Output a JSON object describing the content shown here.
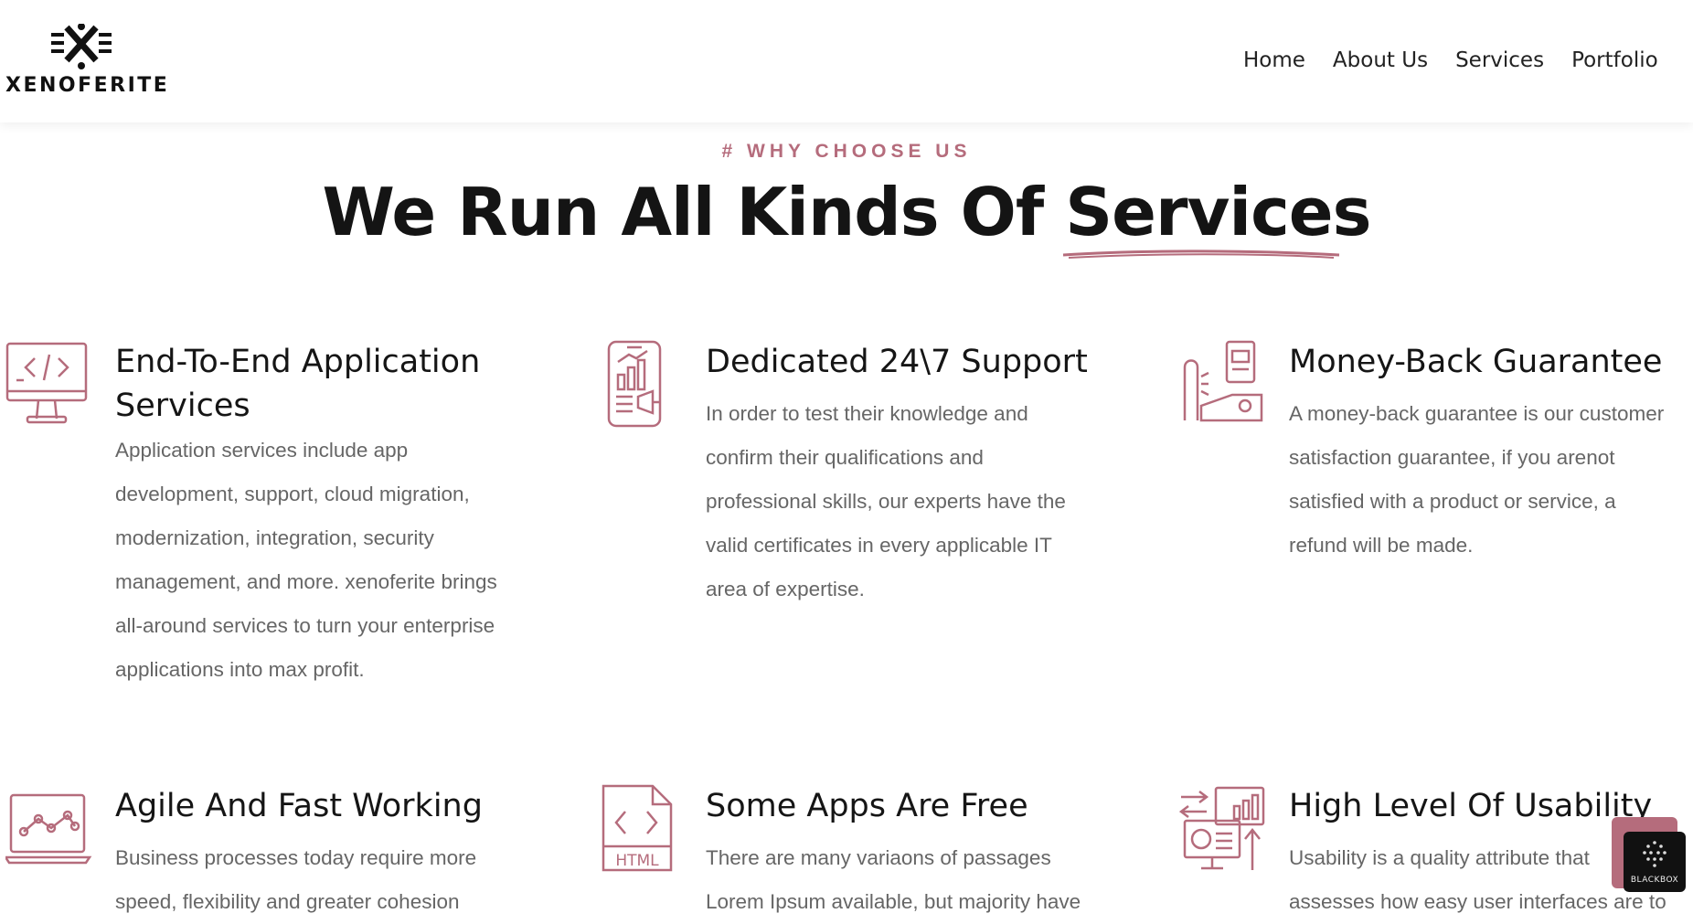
{
  "brand": {
    "name": "XENOFERITE"
  },
  "nav": {
    "items": [
      "Home",
      "About Us",
      "Services",
      "Portfolio"
    ]
  },
  "section": {
    "eyebrow": "# WHY CHOOSE US",
    "headline_prefix": "We Run All Kinds Of ",
    "headline_accent": "Services"
  },
  "cards": [
    {
      "icon": "code-monitor-icon",
      "title_line1": "End-To-End Application",
      "title_line2": "Services",
      "lines": [
        "Application services include app",
        "development, support, cloud migration,",
        "modernization, integration, security",
        "management, and more. xenoferite brings",
        "all-around services to turn your enterprise",
        "applications into max profit."
      ]
    },
    {
      "icon": "mobile-marketing-icon",
      "title_line1": "Dedicated 24\\7 Support",
      "lines": [
        "In order to test their knowledge and",
        "confirm their qualifications and",
        "professional skills, our experts have the",
        "valid certificates in every applicable IT",
        "area of expertise."
      ]
    },
    {
      "icon": "money-back-icon",
      "title_line1": "Money-Back Guarantee",
      "lines": [
        "A money-back guarantee is our customer",
        "satisfaction guarantee, if you arenot",
        "satisfied with a product or service, a",
        "refund will be made."
      ]
    },
    {
      "icon": "analytics-monitor-icon",
      "title_line1": "Agile And Fast Working",
      "lines": [
        "Business processes today require more",
        "speed, flexibility and greater cohesion"
      ]
    },
    {
      "icon": "html-file-icon",
      "title_line1": "Some Apps Are Free",
      "lines": [
        "There are many variaons of passages",
        "Lorem Ipsum available, but majority have"
      ]
    },
    {
      "icon": "usability-dashboard-icon",
      "title_line1": "High Level Of Usability",
      "lines": [
        "Usability is a quality attribute that",
        "assesses how easy user interfaces are to"
      ]
    }
  ],
  "widget": {
    "label": "BLACKBOX",
    "icon": "blackbox-logo-icon"
  },
  "colors": {
    "accent": "#b56c7c",
    "text": "#151515",
    "muted": "#666666"
  }
}
